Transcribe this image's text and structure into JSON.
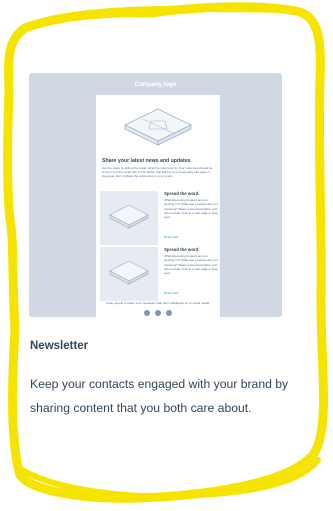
{
  "template_card": {
    "preview": {
      "logo_text": "Company logo",
      "heading": "Share your latest news and updates",
      "intro": "Get the stage by telling the reader what the main topic is. Your main idea should be at the top of the email with a CTA button that links to a corresponding site page or blog post. Don't include the entire story in your email.",
      "sections": [
        {
          "title": "Spread the word.",
          "body": "What interesting projects are you working on? What new products are you releasing? Share a brief description and then include a link to a web page or blog post.",
          "link": "Read more"
        },
        {
          "title": "Spread the word",
          "body": "What interesting projects are you working on? What new products are you releasing? Share a brief description and then include a link to a web page or blog post.",
          "link": "Read more"
        }
      ],
      "footer_text": "Invite people to share your newsletter with their colleagues or on social media.",
      "social_icons": [
        "facebook-icon",
        "twitter-icon",
        "linkedin-icon"
      ]
    },
    "title": "Newsletter",
    "description": "Keep your contacts engaged with your brand by sharing content that you both care about."
  },
  "colors": {
    "highlighter": "#f5e400",
    "preview_background": "#cfd8e3",
    "text": "#33475b",
    "link": "#00a4bd"
  }
}
